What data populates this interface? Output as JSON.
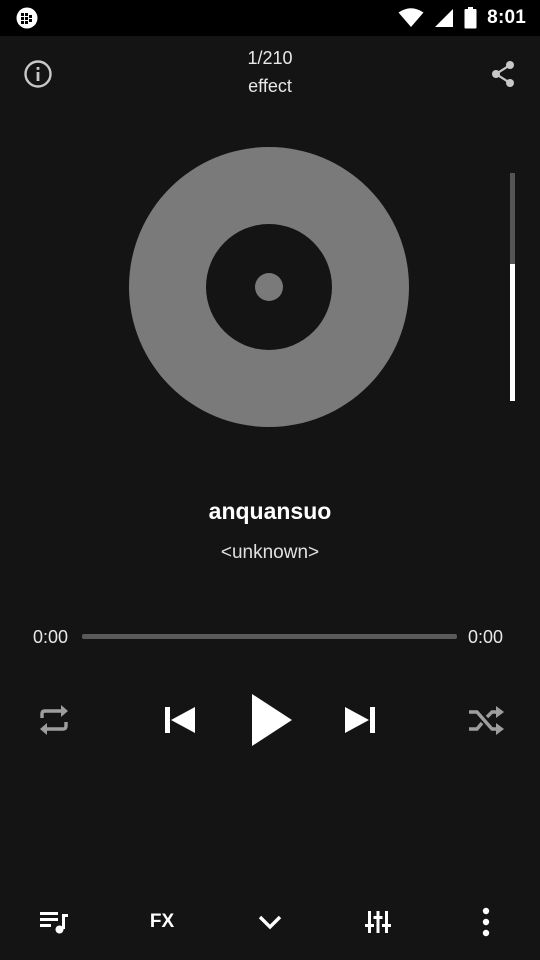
{
  "status_bar": {
    "time": "8:01",
    "icons": [
      "app-notification-icon",
      "wifi-icon",
      "signal-icon",
      "battery-icon"
    ]
  },
  "header": {
    "track_counter": "1/210",
    "playlist_name": "effect",
    "info_icon": "info-icon",
    "share_icon": "share-icon"
  },
  "album_art": {
    "icon": "vinyl-disc-icon",
    "disc_color": "#7a7a7a"
  },
  "volume": {
    "level_fraction": 0.6
  },
  "track": {
    "title": "anquansuo",
    "artist": "<unknown>"
  },
  "progress": {
    "elapsed": "0:00",
    "total": "0:00",
    "fraction": 0
  },
  "controls": {
    "repeat_icon": "repeat-icon",
    "previous_icon": "skip-previous-icon",
    "play_icon": "play-icon",
    "next_icon": "skip-next-icon",
    "shuffle_icon": "shuffle-icon"
  },
  "bottom_bar": {
    "queue_icon": "queue-music-icon",
    "fx_label": "FX",
    "collapse_icon": "chevron-down-icon",
    "equalizer_icon": "equalizer-icon",
    "more_icon": "more-vertical-icon"
  },
  "colors": {
    "background": "#141414",
    "status_bar": "#000000",
    "accent": "#ffffff",
    "muted_icon": "#9e9e9e"
  }
}
